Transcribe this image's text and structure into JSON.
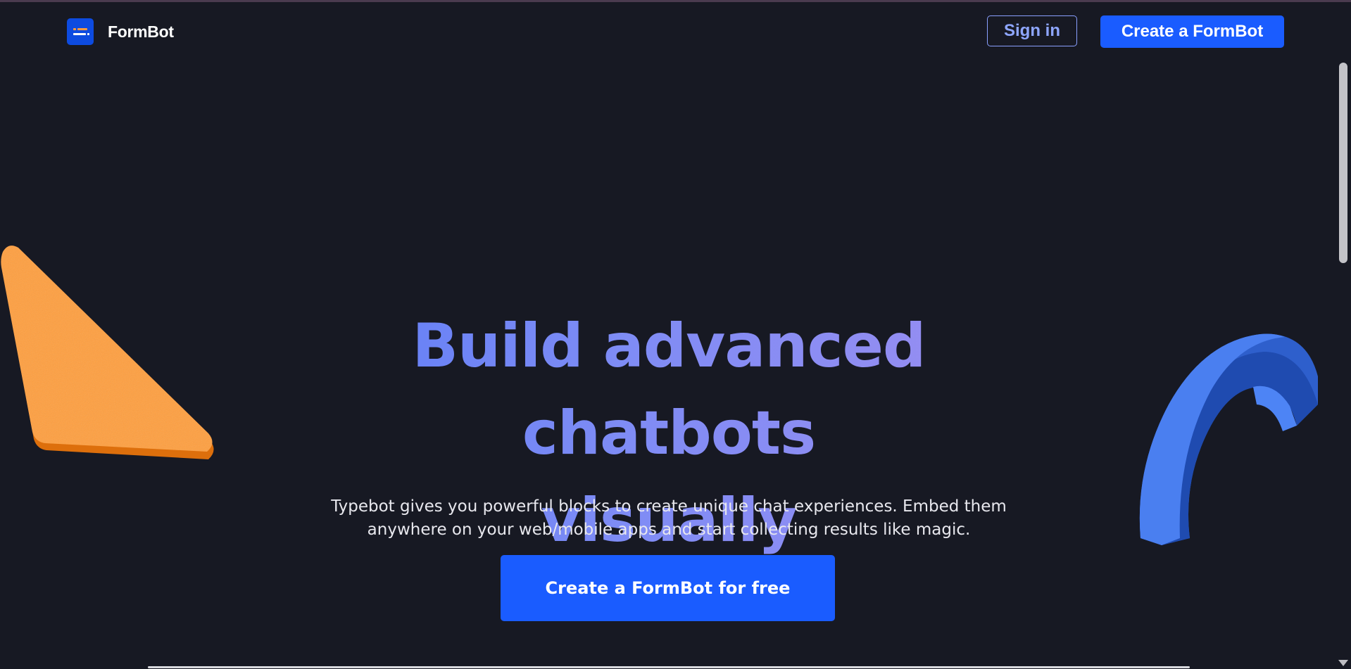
{
  "header": {
    "logo_text": "FormBot",
    "signin_label": "Sign in",
    "create_label": "Create a FormBot"
  },
  "hero": {
    "title_line1": "Build advanced chatbots",
    "title_line2": "visually",
    "subtitle_line1": "Typebot gives you powerful blocks to create unique chat experiences. Embed them",
    "subtitle_line2": "anywhere on your web/mobile apps and start collecting results like magic.",
    "cta_label": "Create a FormBot for free"
  },
  "colors": {
    "background": "#171923",
    "primary": "#1a5cff",
    "title_gradient_start": "#5c7cf6",
    "title_gradient_end": "#9d8ef0",
    "triangle_shape": "#ff9f3f",
    "arc_shape": "#4a7ff0"
  },
  "icons": {
    "logo": "formbot-logo-icon",
    "triangle": "orange-triangle-decoration",
    "arc": "blue-arc-decoration"
  }
}
